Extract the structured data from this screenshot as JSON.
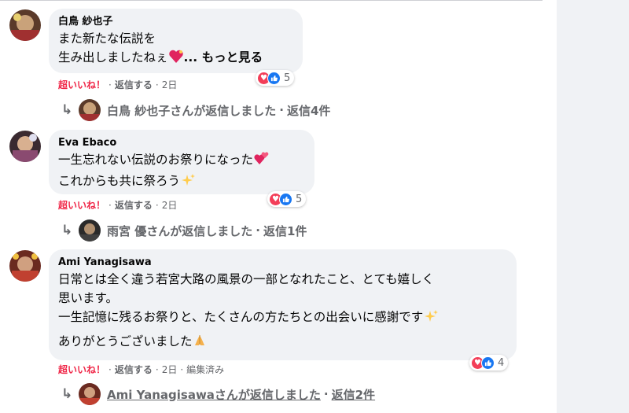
{
  "comments": [
    {
      "author": "白鳥 紗也子",
      "lines": [
        "また新たな伝説を",
        "生み出しましたねぇ"
      ],
      "more_label": "... もっと見る",
      "reaction_count": "5",
      "actions": {
        "reaction": "超いいね！",
        "reply": "返信する",
        "time": "2日"
      },
      "reply_summary": {
        "text": "白鳥 紗也子さんが返信しました",
        "count": "返信4件"
      }
    },
    {
      "author": "Eva Ebaco",
      "lines": [
        "一生忘れない伝説のお祭りになった",
        "これからも共に祭ろう"
      ],
      "reaction_count": "5",
      "actions": {
        "reaction": "超いいね！",
        "reply": "返信する",
        "time": "2日"
      },
      "reply_summary": {
        "text": "雨宮 優さんが返信しました",
        "count": "返信1件"
      }
    },
    {
      "author": "Ami Yanagisawa",
      "lines": [
        "日常とは全く違う若宮大路の風景の一部となれたこと、とても嬉しく",
        "思います。",
        "一生記憶に残るお祭りと、たくさんの方たちとの出会いに感謝です",
        "ありがとうございました"
      ],
      "reaction_count": "4",
      "actions": {
        "reaction": "超いいね！",
        "reply": "返信する",
        "time": "2日",
        "edited": "編集済み"
      },
      "reply_summary": {
        "text": "Ami Yanagisawaさんが返信しました",
        "count": "返信2件"
      }
    }
  ],
  "separator": "·",
  "icons": {
    "heart_emoji": "sparkling-heart-emoji",
    "two_hearts": "two-hearts-emoji",
    "sparkles": "sparkles-emoji",
    "pray": "folded-hands-emoji",
    "reply_arrow": "reply-arrow-icon"
  },
  "colors": {
    "super_like": "#f02849",
    "like_blue": "#1877f2",
    "heart_red": "#f33e58",
    "bubble": "#f0f2f5"
  }
}
